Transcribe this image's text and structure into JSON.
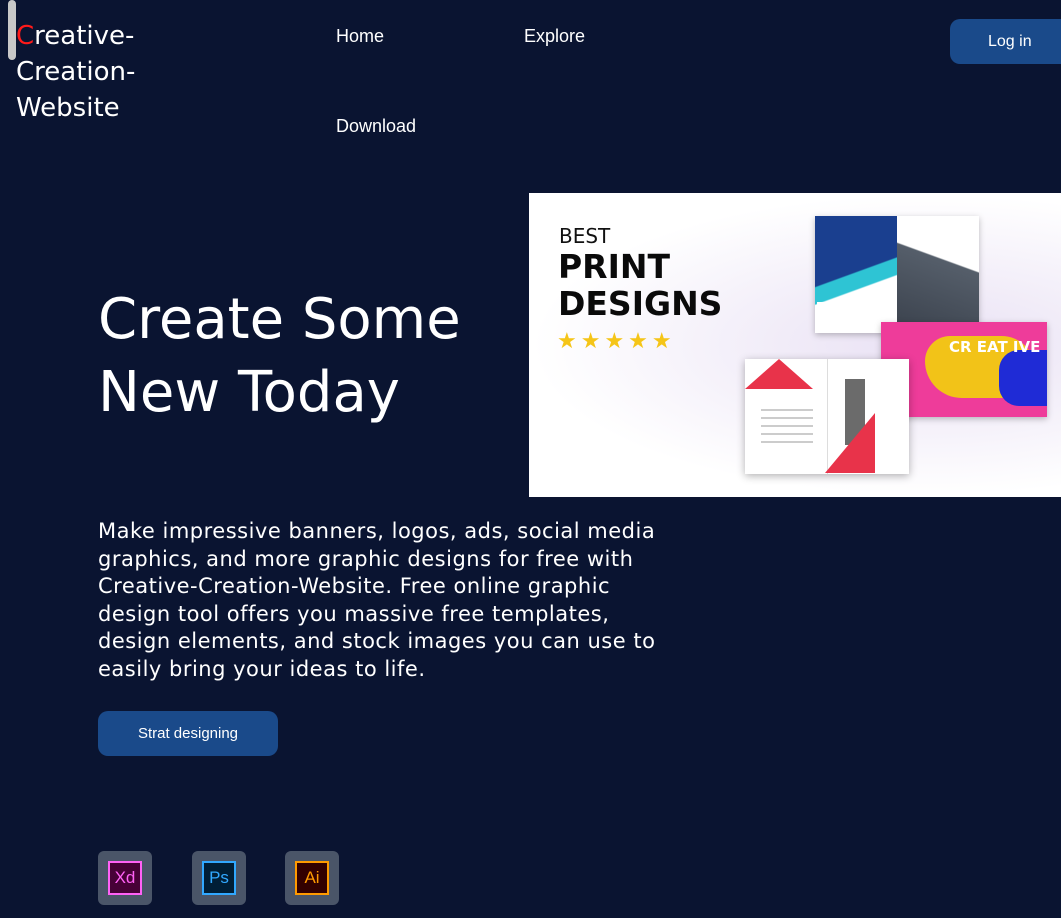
{
  "brand": {
    "first_letter": "C",
    "rest": "reative-Creation-Website",
    "colors": {
      "first_letter": "#ff1a1a",
      "text": "#ffffff"
    }
  },
  "nav": {
    "home": "Home",
    "explore": "Explore",
    "download": "Download",
    "login": "Log in"
  },
  "hero": {
    "title": "Create Some New Today",
    "description": "Make impressive banners, logos, ads, social media graphics, and more graphic designs for free with Creative-Creation-Website. Free online graphic design tool offers you massive free templates, design elements, and stock images you can use to easily bring your ideas to life.",
    "cta": "Strat designing"
  },
  "banner": {
    "line1": "BEST",
    "line2": "PRINT DESIGNS",
    "stars": "★★★★★",
    "rating": 5,
    "creative_text": "CR EAT IVE"
  },
  "tools": [
    {
      "label": "Xd",
      "color": "#ff61f6"
    },
    {
      "label": "Ps",
      "color": "#31a8ff"
    },
    {
      "label": "Ai",
      "color": "#ff9a00"
    }
  ],
  "theme": {
    "background": "#0a1431",
    "button": "#1a4a8a"
  }
}
